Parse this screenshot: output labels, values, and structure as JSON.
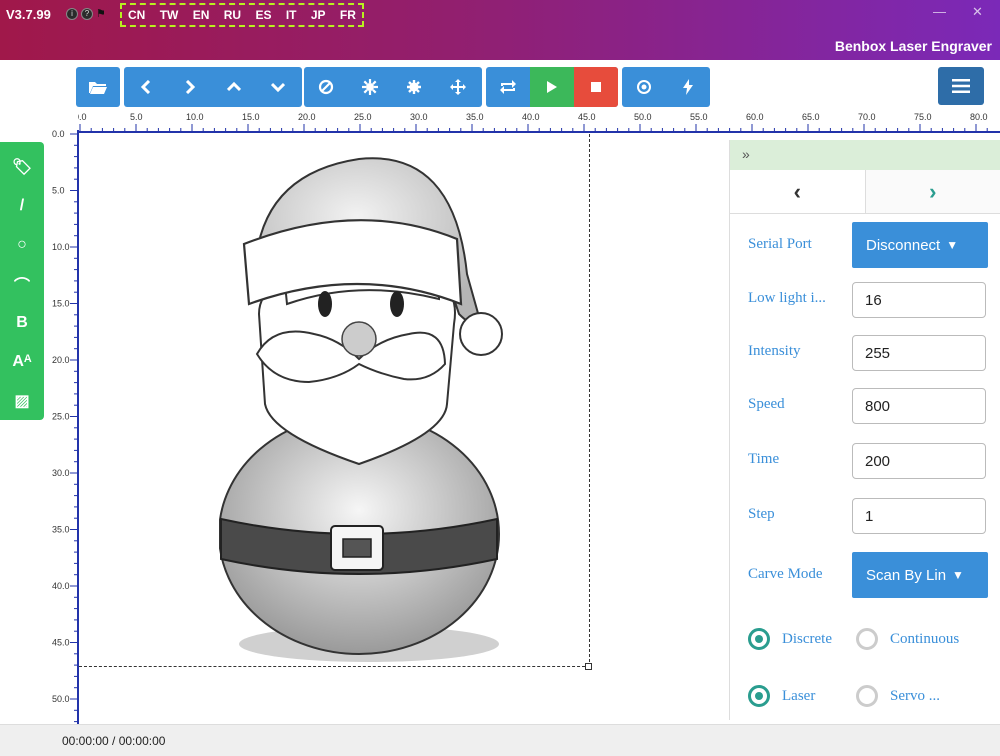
{
  "titlebar": {
    "version": "V3.7.99",
    "languages": [
      "CN",
      "TW",
      "EN",
      "RU",
      "ES",
      "IT",
      "JP",
      "FR"
    ],
    "minimize": "—",
    "close": "✕",
    "app_name": "Benbox Laser Engraver"
  },
  "toolbar": {
    "groups": [
      [
        "folder-open-icon"
      ],
      [
        "chevron-left-icon",
        "chevron-right-icon",
        "chevron-up-icon",
        "chevron-down-icon"
      ],
      [
        "ban-icon",
        "gear-icon",
        "gear-small-icon",
        "move-icon"
      ],
      [
        "repeat-icon",
        "play-icon",
        "stop-icon"
      ],
      [
        "target-icon",
        "bolt-icon"
      ]
    ],
    "menu_icon": "hamburger-menu-icon"
  },
  "ruler": {
    "x_labels": [
      "0.0",
      "5.0",
      "10.0",
      "15.0",
      "20.0",
      "25.0",
      "30.0",
      "35.0",
      "40.0",
      "45.0",
      "50.0",
      "55.0",
      "60.0",
      "65.0",
      "70.0",
      "75.0",
      "80.0"
    ],
    "y_labels": [
      "0.0",
      "5.0",
      "10.0",
      "15.0",
      "20.0",
      "25.0",
      "30.0",
      "35.0",
      "40.0",
      "45.0",
      "50.0"
    ]
  },
  "palette": {
    "tools": [
      {
        "name": "tag-icon",
        "glyph": "🏷"
      },
      {
        "name": "line-icon",
        "glyph": "/"
      },
      {
        "name": "circle-icon",
        "glyph": "○"
      },
      {
        "name": "arc-icon",
        "glyph": "⌒"
      },
      {
        "name": "bold-text-icon",
        "glyph": "B"
      },
      {
        "name": "font-size-icon",
        "glyph": "Aᴬ"
      },
      {
        "name": "image-icon",
        "glyph": "▨"
      }
    ]
  },
  "panel": {
    "collapse": "»",
    "tab_prev": "‹",
    "tab_next": "›",
    "serial_port_label": "Serial Port",
    "serial_port_value": "Disconnect",
    "low_light_label": "Low light i...",
    "low_light_value": "16",
    "intensity_label": "Intensity",
    "intensity_value": "255",
    "speed_label": "Speed",
    "speed_value": "800",
    "time_label": "Time",
    "time_value": "200",
    "step_label": "Step",
    "step_value": "1",
    "carve_mode_label": "Carve Mode",
    "carve_mode_value": "Scan By Lin",
    "mode_discrete": "Discrete",
    "mode_continuous": "Continuous",
    "device_laser": "Laser",
    "device_servo": "Servo ..."
  },
  "status": {
    "time": "00:00:00 / 00:00:00"
  },
  "colors": {
    "toolbar_blue": "#3a8fd9",
    "play_green": "#3cb85a",
    "stop_red": "#e74c3c",
    "palette_green": "#33c15f",
    "radio_teal": "#2a9d8f",
    "language_highlight": "#b8f020"
  }
}
